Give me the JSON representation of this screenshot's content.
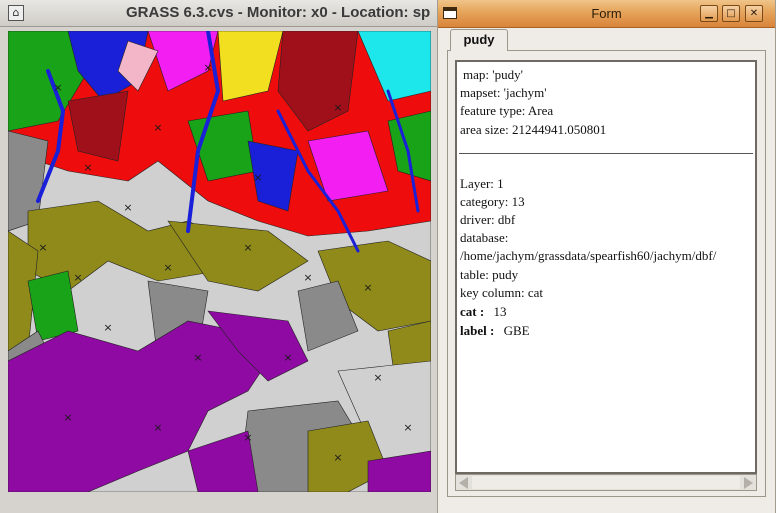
{
  "monitor": {
    "title": "GRASS 6.3.cvs - Monitor: x0 - Location: sp",
    "menu_icon": "window-menu-icon",
    "map_colors": {
      "purple": "#8e0aa2",
      "olive": "#8f8a1a",
      "grey": "#8a8a8a",
      "lightgrey": "#d0d0d0",
      "red": "#ee0c0c",
      "green": "#19a319",
      "blue": "#1a1fd8",
      "magenta": "#f21ef2",
      "cyan": "#1ee7ec",
      "darkred": "#a0101a",
      "pink": "#f2b6c8",
      "yellow": "#f2e020"
    }
  },
  "form": {
    "title": "Form",
    "buttons": {
      "minimize_icon": "minimize-icon",
      "maximize_icon": "maximize-icon",
      "close_icon": "close-icon"
    },
    "tab_label": "pudy",
    "info": {
      "map": "map: 'pudy'",
      "mapset": "mapset: 'jachym'",
      "feature_type": "feature type: Area",
      "area_size": "area size: 21244941.050801"
    },
    "db": {
      "layer": "Layer: 1",
      "category": "category: 13",
      "driver": "driver: dbf",
      "database_label": "database:",
      "database_path": "/home/jachym/grassdata/spearfish60/jachym/dbf/",
      "table": "table: pudy",
      "key_column": "key column: cat"
    },
    "attributes": [
      {
        "name": "cat :",
        "value": "13"
      },
      {
        "name": "label :",
        "value": "GBE"
      }
    ]
  }
}
